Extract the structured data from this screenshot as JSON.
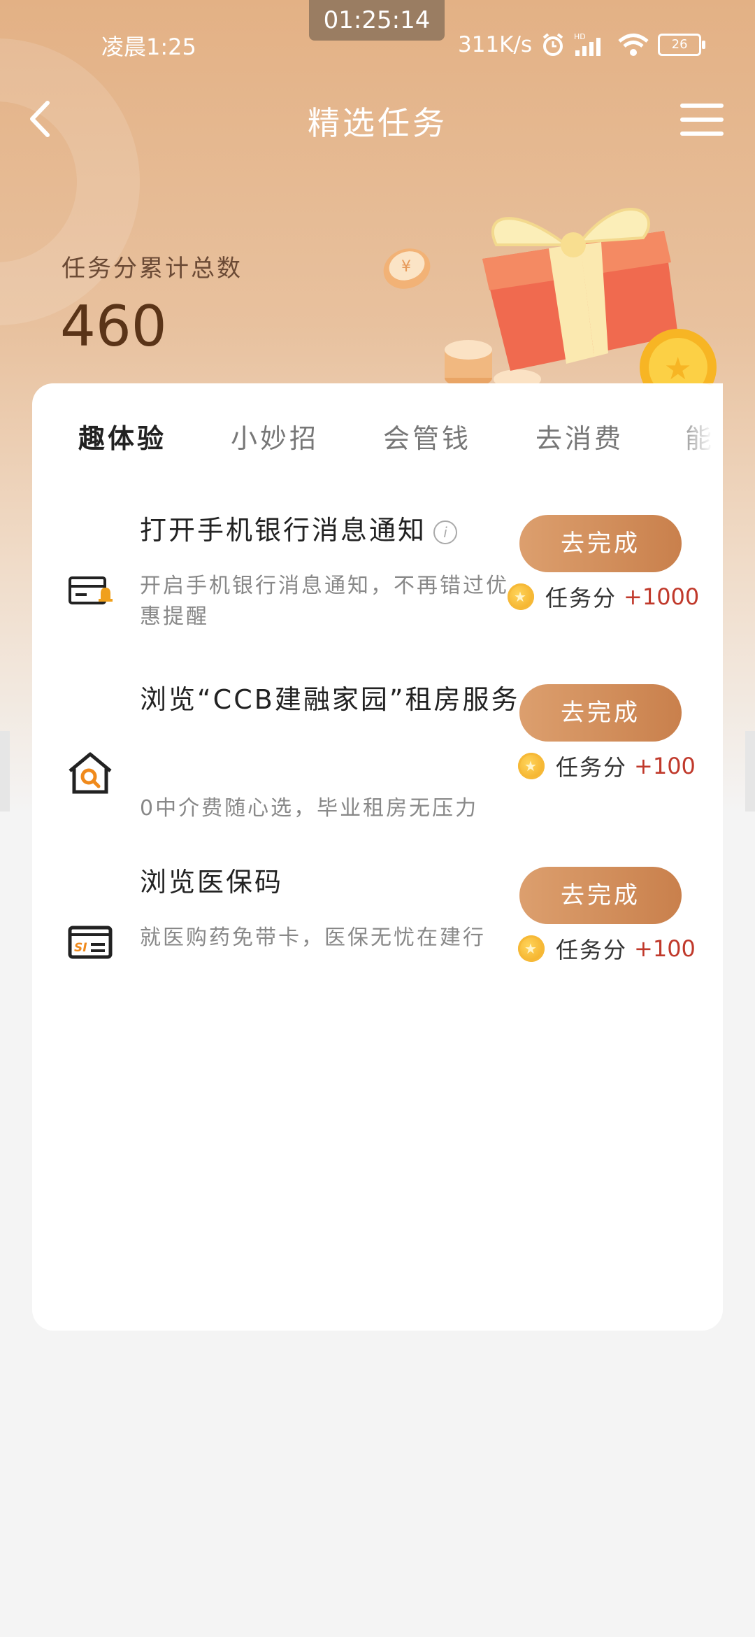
{
  "status_bar": {
    "left_time": "凌晨1:25",
    "center_time": "01:25:14",
    "net_speed": "311K/s",
    "battery": "26"
  },
  "header": {
    "title": "精选任务"
  },
  "score": {
    "label": "任务分累计总数",
    "value": "460"
  },
  "tabs": [
    {
      "label": "趣体验",
      "active": true
    },
    {
      "label": "小妙招",
      "active": false
    },
    {
      "label": "会管钱",
      "active": false
    },
    {
      "label": "去消费",
      "active": false
    },
    {
      "label": "能",
      "active": false
    }
  ],
  "tasks": [
    {
      "icon": "notification-card-icon",
      "title": "打开手机银行消息通知",
      "desc": "开启手机银行消息通知，不再错过优惠提醒",
      "button": "去完成",
      "reward_label": "任务分",
      "reward_points": "+1000"
    },
    {
      "icon": "house-search-icon",
      "title": "浏览“CCB建融家园”租房服务",
      "desc": "0中介费随心选，毕业租房无压力",
      "button": "去完成",
      "reward_label": "任务分",
      "reward_points": "+100"
    },
    {
      "icon": "medical-insurance-card-icon",
      "title": "浏览医保码",
      "desc": "就医购药免带卡，医保无忧在建行",
      "button": "去完成",
      "reward_label": "任务分",
      "reward_points": "+100"
    }
  ],
  "colors": {
    "header_gradient_top": "#e3b185",
    "button": "#d39161",
    "points": "#c0392b",
    "score": "#5a3418"
  }
}
